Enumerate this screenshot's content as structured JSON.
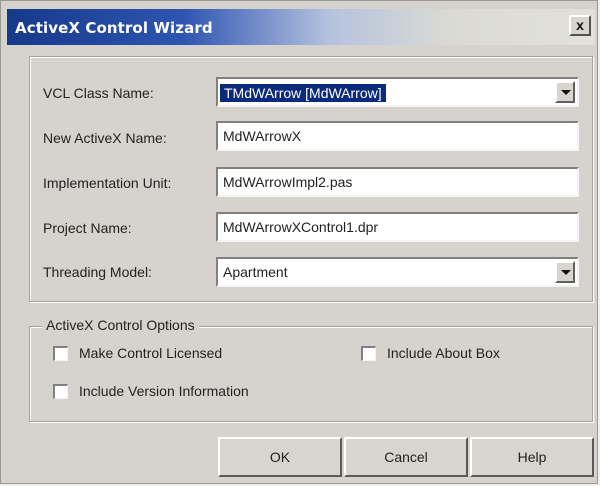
{
  "window": {
    "title": "ActiveX Control Wizard",
    "close_label": "x"
  },
  "fields": [
    {
      "label": "VCL Class Name:",
      "value": "TMdWArrow  [MdWArrow]",
      "type": "dropdown"
    },
    {
      "label": "New ActiveX Name:",
      "value": "MdWArrowX",
      "type": "text"
    },
    {
      "label": "Implementation Unit:",
      "value": "MdWArrowImpl2.pas",
      "type": "text"
    },
    {
      "label": "Project Name:",
      "value": "MdWArrowXControl1.dpr",
      "type": "text"
    },
    {
      "label": "Threading Model:",
      "value": "Apartment",
      "type": "dropdown"
    }
  ],
  "options": {
    "legend": "ActiveX Control Options",
    "checkboxes": [
      {
        "label": "Make Control Licensed",
        "checked": false
      },
      {
        "label": "Include About Box",
        "checked": false
      },
      {
        "label": "Include Version Information",
        "checked": false
      }
    ]
  },
  "buttons": {
    "ok": "OK",
    "cancel": "Cancel",
    "help": "Help"
  }
}
